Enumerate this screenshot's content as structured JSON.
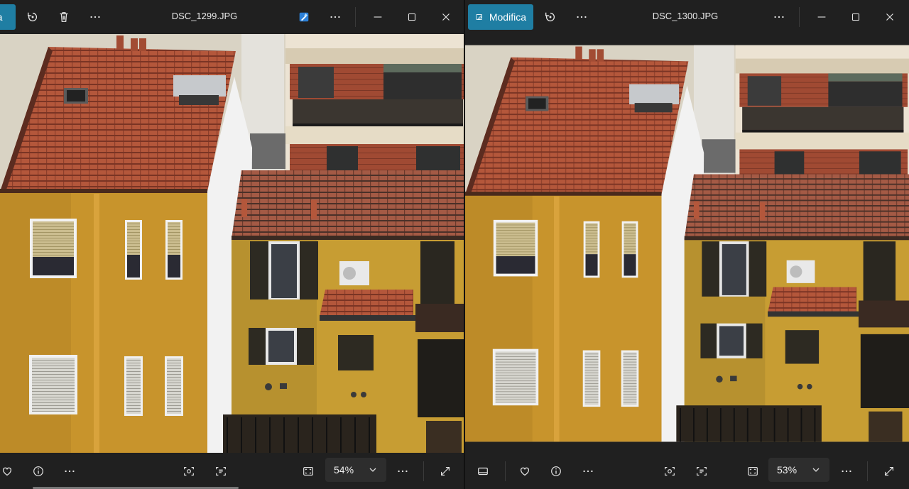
{
  "left": {
    "edit_label": "ca",
    "file_name": "DSC_1299.JPG",
    "zoom": "54%"
  },
  "right": {
    "edit_label": "Modifica",
    "file_name": "DSC_1300.JPG",
    "zoom": "53%"
  },
  "colors": {
    "toolbar_bg": "#202020",
    "accent": "#1f7ea3",
    "facade_yellow": "#c89a2e",
    "roof_terracotta": "#b3553a"
  },
  "icons": {
    "rotate": "rotate-icon",
    "delete": "trash-icon",
    "more": "more-icon",
    "editor": "photo-editor-icon",
    "minimize": "minimize-icon",
    "maximize": "maximize-icon",
    "close": "close-icon",
    "favorite": "heart-icon",
    "info": "info-icon",
    "visual_search": "visual-search-icon",
    "text_recognition": "scan-text-icon",
    "fit": "fit-to-window-icon",
    "fullscreen": "fullscreen-icon",
    "filmstrip": "filmstrip-icon"
  }
}
